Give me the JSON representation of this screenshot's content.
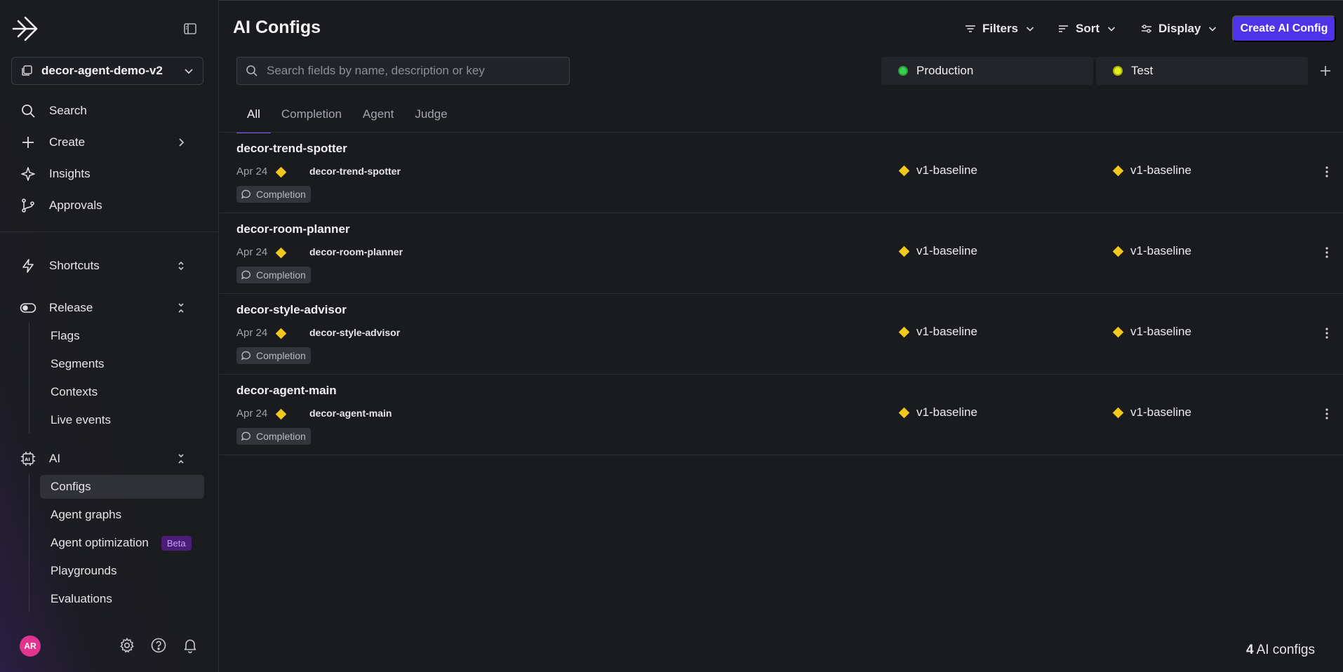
{
  "sidebar": {
    "project_name": "decor-agent-demo-v2",
    "nav": {
      "search": "Search",
      "create": "Create",
      "insights": "Insights",
      "approvals": "Approvals",
      "shortcuts": "Shortcuts",
      "release": "Release",
      "ai": "AI"
    },
    "release_items": [
      "Flags",
      "Segments",
      "Contexts",
      "Live events"
    ],
    "ai_items": [
      "Configs",
      "Agent graphs",
      "Agent optimization",
      "Playgrounds",
      "Evaluations"
    ],
    "beta_label": "Beta",
    "avatar_initials": "AR"
  },
  "header": {
    "title": "AI Configs",
    "filters_label": "Filters",
    "sort_label": "Sort",
    "display_label": "Display",
    "create_label": "Create AI Config"
  },
  "search": {
    "placeholder": "Search fields by name, description or key"
  },
  "environments": [
    {
      "name": "Production",
      "color": "#3ccf4e"
    },
    {
      "name": "Test",
      "color": "#e3f01c"
    }
  ],
  "tabs": [
    "All",
    "Completion",
    "Agent",
    "Judge"
  ],
  "configs": [
    {
      "name": "decor-trend-spotter",
      "date": "Apr 24",
      "key": "decor-trend-spotter",
      "mode": "Completion",
      "production": "v1-baseline",
      "test": "v1-baseline"
    },
    {
      "name": "decor-room-planner",
      "date": "Apr 24",
      "key": "decor-room-planner",
      "mode": "Completion",
      "production": "v1-baseline",
      "test": "v1-baseline"
    },
    {
      "name": "decor-style-advisor",
      "date": "Apr 24",
      "key": "decor-style-advisor",
      "mode": "Completion",
      "production": "v1-baseline",
      "test": "v1-baseline"
    },
    {
      "name": "decor-agent-main",
      "date": "Apr 24",
      "key": "decor-agent-main",
      "mode": "Completion",
      "production": "v1-baseline",
      "test": "v1-baseline"
    }
  ],
  "footer": {
    "count": "4",
    "count_label": "AI configs"
  },
  "colors": {
    "accent": "#4e33e8",
    "tab_underline": "#7b61ff",
    "variation_diamond": "#f2c81d",
    "avatar": "#e0348f"
  }
}
